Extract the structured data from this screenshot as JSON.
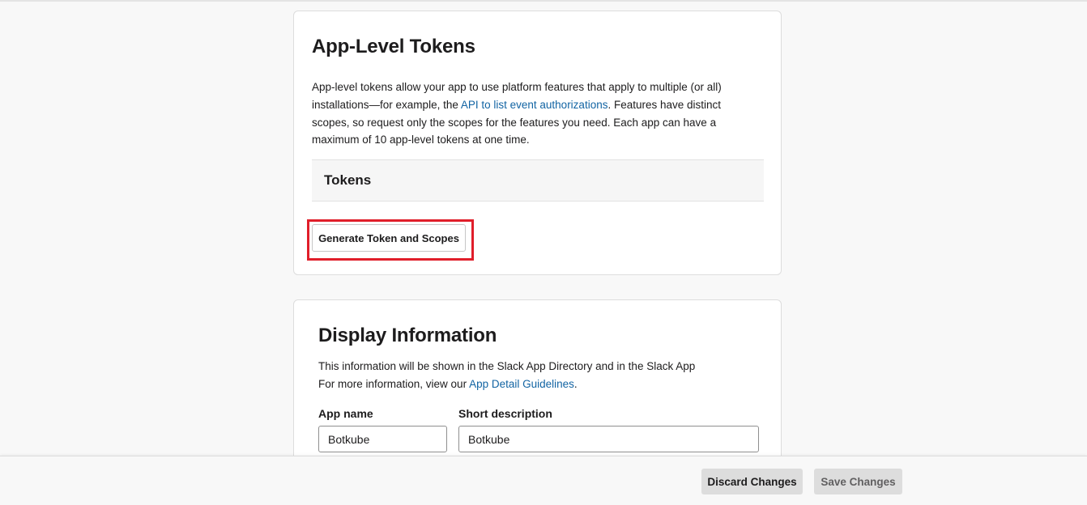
{
  "app_level_tokens": {
    "title": "App-Level Tokens",
    "description_part1": "App-level tokens allow your app to use platform features that apply to multiple (or all) installations—for example, the ",
    "description_link": "API to list event authorizations",
    "description_part2": ". Features have distinct scopes, so request only the scopes for the features you need. Each app can have a maximum of 10 app-level tokens at one time.",
    "tokens_header": "Tokens",
    "generate_button": "Generate Token and Scopes",
    "highlight_color": "#e01e2a"
  },
  "display_information": {
    "title": "Display Information",
    "line1": "This information will be shown in the Slack App Directory and in the Slack App",
    "line2_prefix": "For more information, view our ",
    "line2_link": "App Detail Guidelines",
    "line2_suffix": ".",
    "app_name_label": "App name",
    "app_name_value": "Botkube",
    "short_description_label": "Short description",
    "short_description_value": "Botkube"
  },
  "footer": {
    "discard_label": "Discard Changes",
    "save_label": "Save Changes"
  },
  "colors": {
    "link": "#1264a3",
    "background": "#f8f8f8",
    "button_gray": "#dddddd"
  }
}
